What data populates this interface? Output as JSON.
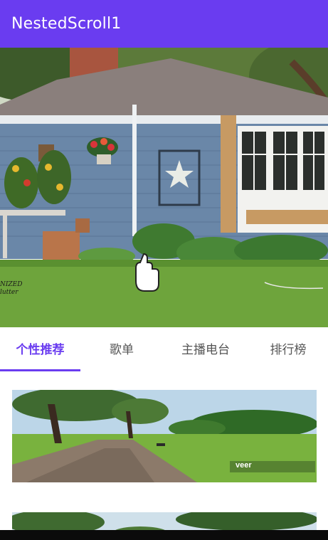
{
  "app_bar": {
    "title": "NestedScroll1"
  },
  "hero": {
    "image_icon": "house-photo",
    "watermark": "NIZED\nlutter",
    "cursor_icon": "hand-pointer-icon"
  },
  "tabs": [
    {
      "label": "个性推荐",
      "active": true
    },
    {
      "label": "歌单",
      "active": false
    },
    {
      "label": "主播电台",
      "active": false
    },
    {
      "label": "排行榜",
      "active": false
    }
  ],
  "cards": [
    {
      "image_icon": "park-path-photo",
      "watermark": "veer"
    },
    {
      "image_icon": "park-trees-photo"
    }
  ],
  "colors": {
    "accent": "#6a3cf0",
    "tab_inactive": "#555555"
  }
}
